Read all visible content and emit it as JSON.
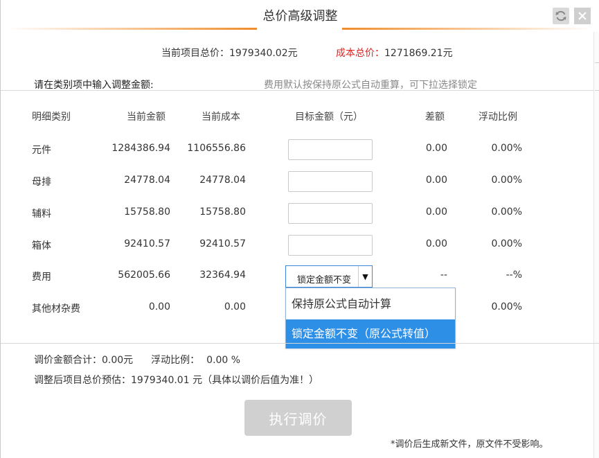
{
  "dialog": {
    "title": "总价高级调整",
    "refresh_icon": "refresh-icon",
    "close_icon": "close-icon"
  },
  "summary": {
    "current_total_label": "当前项目总价：",
    "current_total_value": "1979340.02元",
    "cost_total_label": "成本总价：",
    "cost_total_value": "1271869.21元"
  },
  "instruction": "请在类别项中输入调整金额:",
  "hint": "费用默认按保持原公式自动重算，可下拉选择锁定",
  "table": {
    "headers": [
      "明细类别",
      "当前金额",
      "当前成本",
      "目标金额（元）",
      "差额",
      "浮动比例"
    ],
    "rows": [
      {
        "category": "元件",
        "amount": "1284386.94",
        "cost": "1106556.86",
        "diff": "0.00",
        "ratio": "0.00%"
      },
      {
        "category": "母排",
        "amount": "24778.04",
        "cost": "24778.04",
        "diff": "0.00",
        "ratio": "0.00%"
      },
      {
        "category": "辅料",
        "amount": "15758.80",
        "cost": "15758.80",
        "diff": "0.00",
        "ratio": "0.00%"
      },
      {
        "category": "箱体",
        "amount": "92410.57",
        "cost": "92410.57",
        "diff": "0.00",
        "ratio": "0.00%"
      },
      {
        "category": "费用",
        "amount": "562005.66",
        "cost": "32364.94",
        "diff": "--",
        "ratio": "--%"
      },
      {
        "category": "其他材杂费",
        "amount": "0.00",
        "cost": "0.00",
        "diff": "",
        "ratio": "0.00%"
      }
    ],
    "fee_select": {
      "selected": "锁定金额不变",
      "arrow": "▼",
      "options": [
        "保持原公式自动计算",
        "锁定金额不变（原公式转值）"
      ]
    }
  },
  "footer": {
    "adjust_total_label": "调价金额合计：",
    "adjust_total_value": "0.00元",
    "float_ratio_label": "浮动比例：",
    "float_ratio_value": "0.00 %",
    "estimate_text": "调整后项目总价预估：1979340.01 元（具体以调价后值为准！）"
  },
  "exec_button": "执行调价",
  "note": "*调价后生成新文件，原文件不受影响。",
  "colors": {
    "accent_orange": "#f08c28",
    "selected_blue": "#2e8fe6",
    "cost_label_red": "#e02020"
  }
}
